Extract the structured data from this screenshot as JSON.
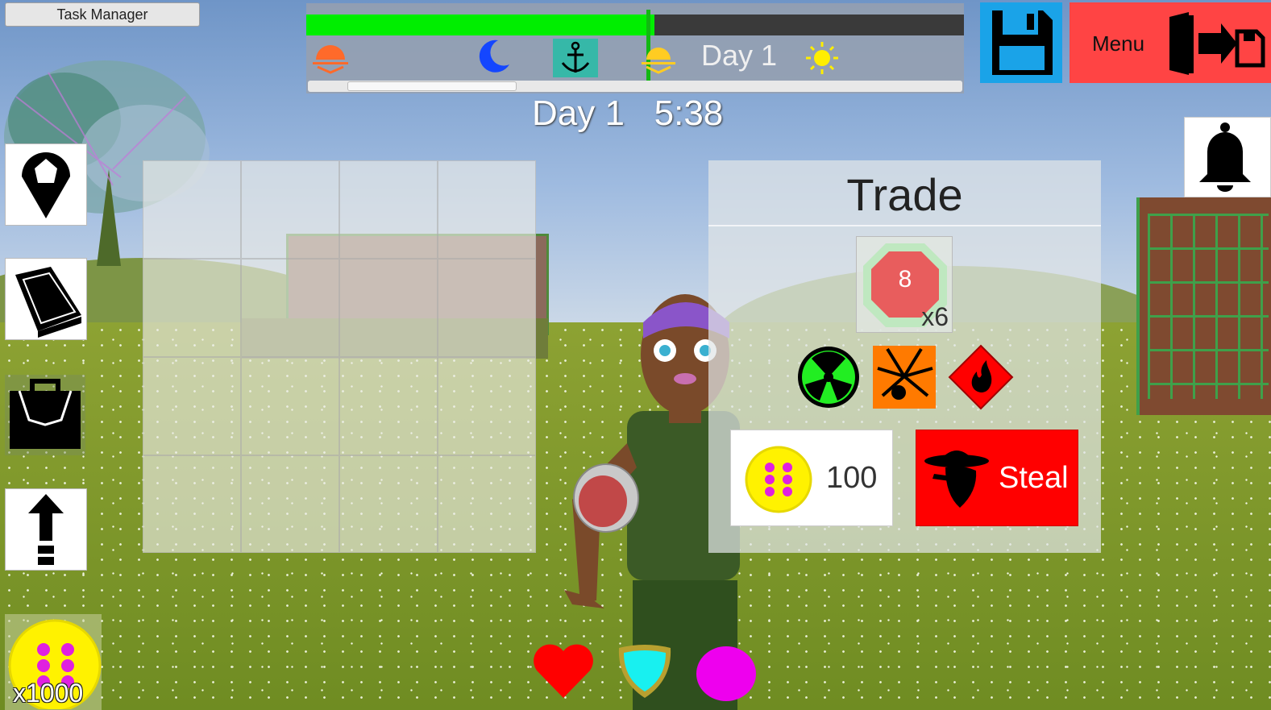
{
  "task_manager": {
    "label": "Task Manager"
  },
  "time_bar": {
    "day_label": "Day 1",
    "progress": 0.53,
    "colors": {
      "fill": "#00ee00",
      "track": "#3a3a3a",
      "marker": "#12b812"
    },
    "icons": [
      "sunset-icon",
      "moon-icon",
      "anchor-icon",
      "sunrise-icon",
      "sun-icon"
    ],
    "scroll_position": 0.06
  },
  "clock": {
    "day": "Day 1",
    "time": "5:38"
  },
  "top_right": {
    "menu_label": "Menu",
    "colors": {
      "save": "#1aa3e8",
      "menu": "#ff4444"
    }
  },
  "sidebar": {
    "items": [
      "map-pin",
      "book",
      "backpack",
      "upgrade-arrow"
    ]
  },
  "currency": {
    "amount": "x1000",
    "color": "#fff200"
  },
  "trade": {
    "title": "Trade",
    "item": {
      "count": "x6"
    },
    "hazards": [
      "radioactive-icon",
      "explosive-icon",
      "flammable-icon"
    ],
    "price": "100",
    "steal_label": "Steal",
    "colors": {
      "steal": "#ff0000"
    }
  },
  "status_icons": [
    "heart-icon",
    "shield-icon",
    "mana-orb-icon"
  ]
}
